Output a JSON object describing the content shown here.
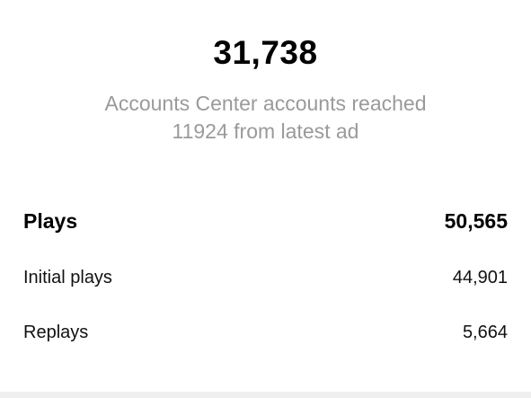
{
  "summary": {
    "total": "31,738",
    "subtitle_line1": "Accounts Center accounts reached",
    "subtitle_line2": "11924 from latest ad"
  },
  "metrics": {
    "plays": {
      "label": "Plays",
      "value": "50,565"
    },
    "initial_plays": {
      "label": "Initial plays",
      "value": "44,901"
    },
    "replays": {
      "label": "Replays",
      "value": "5,664"
    }
  }
}
